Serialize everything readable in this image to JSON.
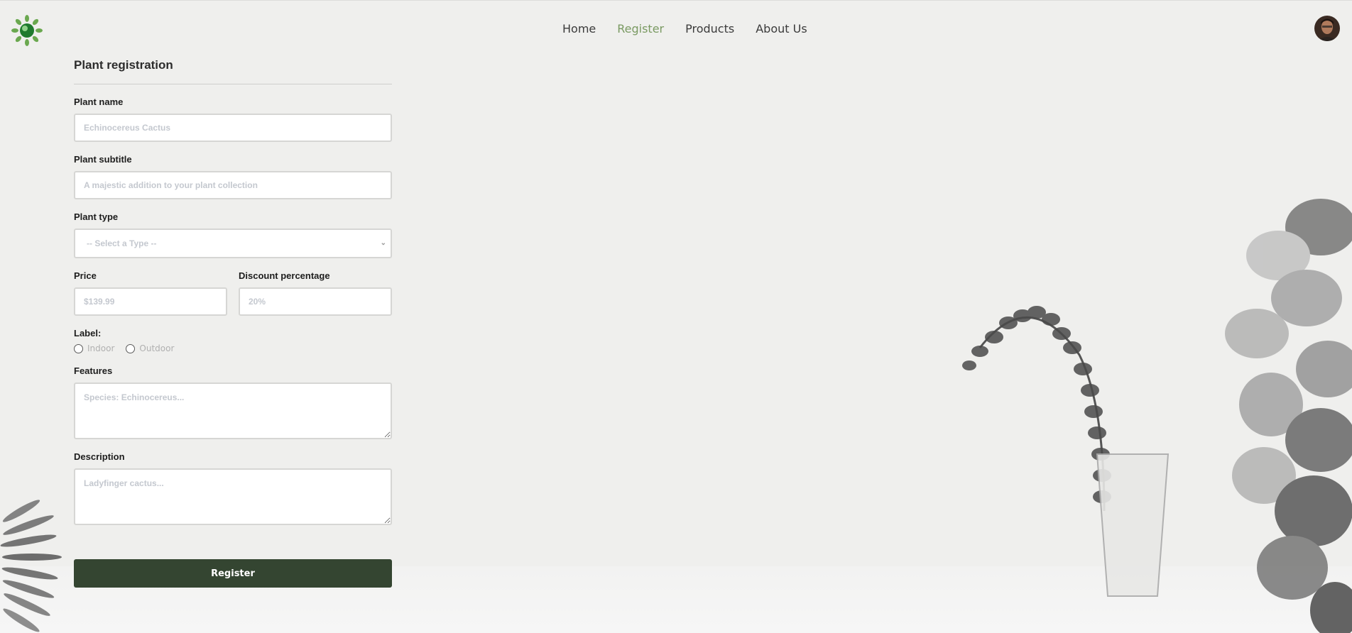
{
  "nav": {
    "items": [
      {
        "label": "Home",
        "active": false
      },
      {
        "label": "Register",
        "active": true
      },
      {
        "label": "Products",
        "active": false
      },
      {
        "label": "About Us",
        "active": false
      }
    ]
  },
  "form": {
    "title": "Plant registration",
    "plant_name": {
      "label": "Plant name",
      "placeholder": "Echinocereus Cactus",
      "value": ""
    },
    "plant_subtitle": {
      "label": "Plant subtitle",
      "placeholder": "A majestic addition to your plant collection",
      "value": ""
    },
    "plant_type": {
      "label": "Plant type",
      "selected": "-- Select a Type --"
    },
    "price": {
      "label": "Price",
      "placeholder": "$139.99",
      "value": ""
    },
    "discount": {
      "label": "Discount percentage",
      "placeholder": "20%",
      "value": ""
    },
    "label_group": {
      "label": "Label:",
      "options": [
        {
          "label": "Indoor",
          "checked": false
        },
        {
          "label": "Outdoor",
          "checked": false
        }
      ]
    },
    "features": {
      "label": "Features",
      "placeholder": "Species: Echinocereus..."
    },
    "description": {
      "label": "Description",
      "placeholder": "Ladyfinger cactus..."
    },
    "submit_label": "Register"
  },
  "icons": {
    "logo": "plant-logo-icon",
    "avatar": "user-avatar",
    "select_chevron": "chevron-down-icon"
  },
  "colors": {
    "background": "#efefed",
    "nav_active": "#7a9a62",
    "button": "#344531",
    "button_text": "#ffffff"
  }
}
